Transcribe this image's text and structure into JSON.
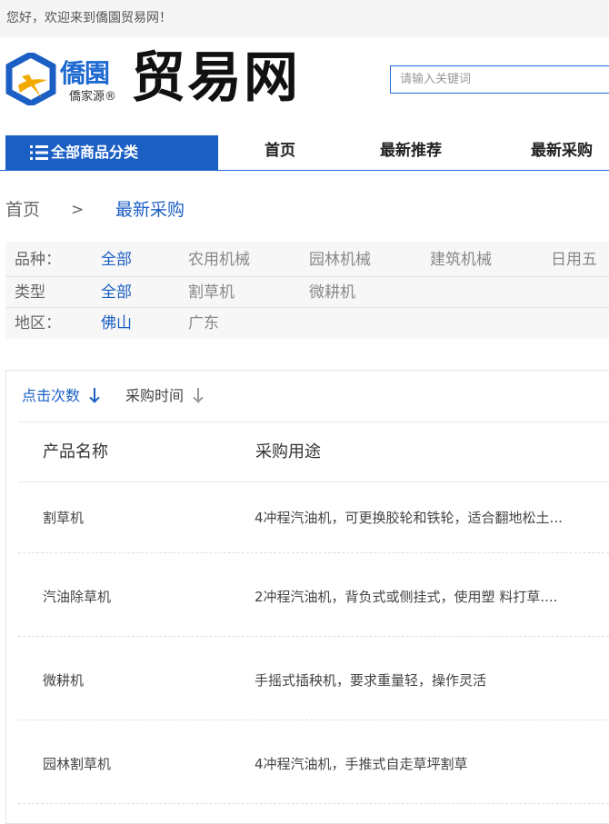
{
  "topbar": {
    "welcome": "您好，欢迎来到僑園贸易网！"
  },
  "header": {
    "brand_name": "僑園",
    "brand_sub": "僑家源®",
    "site_title": "贸易网",
    "search_placeholder": "请输入关键词",
    "brand_color": "#1b5fc4"
  },
  "nav": {
    "all_categories": "全部商品分类",
    "items": [
      "首页",
      "最新推荐",
      "最新采购"
    ]
  },
  "breadcrumb": {
    "home": "首页",
    "separator": ">",
    "current": "最新采购"
  },
  "filters": {
    "variety": {
      "label": "品种：",
      "options": [
        "全部",
        "农用机械",
        "园林机械",
        "建筑机械",
        "日用五"
      ]
    },
    "type": {
      "label": "类型",
      "options": [
        "全部",
        "割草机",
        "微耕机"
      ]
    },
    "region": {
      "label": "地区：",
      "options": [
        "佛山",
        "广东"
      ]
    }
  },
  "sort": {
    "clicks": "点击次数",
    "purchase_time": "采购时间"
  },
  "table": {
    "headers": [
      "产品名称",
      "采购用途"
    ],
    "rows": [
      {
        "name": "割草机",
        "purpose": "4冲程汽油机，可更换胶轮和铁轮，适合翻地松土..."
      },
      {
        "name": "汽油除草机",
        "purpose": "2冲程汽油机，背负式或侧挂式，使用塑 料打草...."
      },
      {
        "name": "微耕机",
        "purpose": "手摇式插秧机，要求重量轻，操作灵活"
      },
      {
        "name": "园林割草机",
        "purpose": "4冲程汽油机，手推式自走草坪割草"
      }
    ]
  }
}
